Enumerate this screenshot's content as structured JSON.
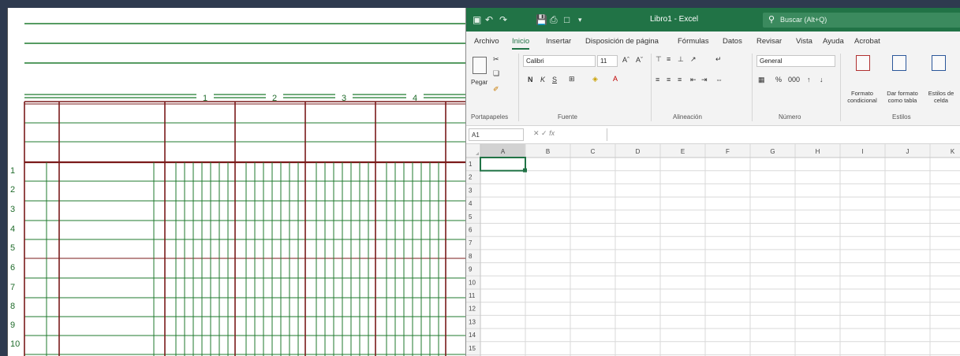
{
  "ledger": {
    "column_numbers": [
      "1",
      "2",
      "3",
      "4"
    ],
    "row_numbers": [
      "1",
      "2",
      "3",
      "4",
      "5",
      "6",
      "7",
      "8",
      "9",
      "10"
    ],
    "colors": {
      "green": "#1f7a2e",
      "red": "#7a1a1a"
    }
  },
  "excel": {
    "title": "Libro1 - Excel",
    "search_placeholder": "Buscar (Alt+Q)",
    "tabs": [
      "Archivo",
      "Inicio",
      "Insertar",
      "Disposición de página",
      "Fórmulas",
      "Datos",
      "Revisar",
      "Vista",
      "Ayuda",
      "Acrobat"
    ],
    "active_tab": "Inicio",
    "ribbon": {
      "clipboard": {
        "paste_label": "Pegar",
        "group_label": "Portapapeles"
      },
      "font": {
        "font_name": "Calibri",
        "font_size": "11",
        "bold": "N",
        "italic": "K",
        "underline": "S",
        "group_label": "Fuente"
      },
      "alignment": {
        "group_label": "Alineación"
      },
      "number": {
        "format": "General",
        "group_label": "Número"
      },
      "styles": {
        "conditional_format": "Formato condicional",
        "format_as_table": "Dar formato como tabla",
        "cell_styles": "Estilos de celda",
        "group_label": "Estilos"
      }
    },
    "name_box": "A1",
    "fx": "fx",
    "column_headers": [
      "A",
      "B",
      "C",
      "D",
      "E",
      "F",
      "G",
      "H",
      "I",
      "J",
      "K"
    ],
    "row_headers": [
      "1",
      "2",
      "3",
      "4",
      "5",
      "6",
      "7",
      "8",
      "9",
      "10",
      "11",
      "12",
      "13",
      "14",
      "15"
    ],
    "colors": {
      "brand": "#217346",
      "ribbon": "#f3f3f3",
      "grid": "#d9d9d9"
    }
  }
}
